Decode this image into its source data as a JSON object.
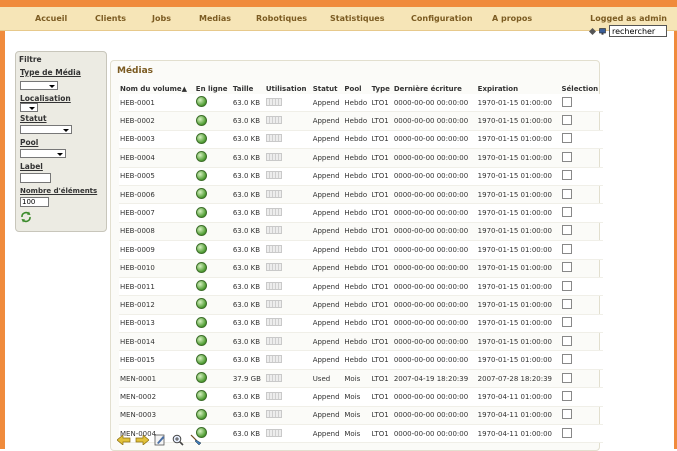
{
  "nav": [
    "Accueil",
    "Clients",
    "Jobs",
    "Medias",
    "Robotiques",
    "Statistiques",
    "Configuration",
    "A propos"
  ],
  "logged": {
    "text": "Logged as admin",
    "search_value": "rechercher"
  },
  "filter": {
    "title": "Filtre",
    "type_media": "Type de Média",
    "localisation": "Localisation",
    "statut": "Statut",
    "pool": "Pool",
    "label": "Label",
    "nombre": "Nombre d'éléments",
    "nombre_value": "100"
  },
  "panel": {
    "title": "Médias",
    "columns": [
      "Nom du volume▲",
      "En ligne",
      "Taille",
      "Utilisation",
      "Statut",
      "Pool",
      "Type",
      "Dernière écriture",
      "Expiration",
      "Sélection"
    ]
  },
  "rows": [
    {
      "name": "HEB-0001",
      "size": "63.0 KB",
      "status": "Append",
      "pool": "Hebdo",
      "type": "LTO1",
      "last": "0000-00-00 00:00:00",
      "exp": "1970-01-15 01:00:00"
    },
    {
      "name": "HEB-0002",
      "size": "63.0 KB",
      "status": "Append",
      "pool": "Hebdo",
      "type": "LTO1",
      "last": "0000-00-00 00:00:00",
      "exp": "1970-01-15 01:00:00"
    },
    {
      "name": "HEB-0003",
      "size": "63.0 KB",
      "status": "Append",
      "pool": "Hebdo",
      "type": "LTO1",
      "last": "0000-00-00 00:00:00",
      "exp": "1970-01-15 01:00:00"
    },
    {
      "name": "HEB-0004",
      "size": "63.0 KB",
      "status": "Append",
      "pool": "Hebdo",
      "type": "LTO1",
      "last": "0000-00-00 00:00:00",
      "exp": "1970-01-15 01:00:00"
    },
    {
      "name": "HEB-0005",
      "size": "63.0 KB",
      "status": "Append",
      "pool": "Hebdo",
      "type": "LTO1",
      "last": "0000-00-00 00:00:00",
      "exp": "1970-01-15 01:00:00"
    },
    {
      "name": "HEB-0006",
      "size": "63.0 KB",
      "status": "Append",
      "pool": "Hebdo",
      "type": "LTO1",
      "last": "0000-00-00 00:00:00",
      "exp": "1970-01-15 01:00:00"
    },
    {
      "name": "HEB-0007",
      "size": "63.0 KB",
      "status": "Append",
      "pool": "Hebdo",
      "type": "LTO1",
      "last": "0000-00-00 00:00:00",
      "exp": "1970-01-15 01:00:00"
    },
    {
      "name": "HEB-0008",
      "size": "63.0 KB",
      "status": "Append",
      "pool": "Hebdo",
      "type": "LTO1",
      "last": "0000-00-00 00:00:00",
      "exp": "1970-01-15 01:00:00"
    },
    {
      "name": "HEB-0009",
      "size": "63.0 KB",
      "status": "Append",
      "pool": "Hebdo",
      "type": "LTO1",
      "last": "0000-00-00 00:00:00",
      "exp": "1970-01-15 01:00:00"
    },
    {
      "name": "HEB-0010",
      "size": "63.0 KB",
      "status": "Append",
      "pool": "Hebdo",
      "type": "LTO1",
      "last": "0000-00-00 00:00:00",
      "exp": "1970-01-15 01:00:00"
    },
    {
      "name": "HEB-0011",
      "size": "63.0 KB",
      "status": "Append",
      "pool": "Hebdo",
      "type": "LTO1",
      "last": "0000-00-00 00:00:00",
      "exp": "1970-01-15 01:00:00"
    },
    {
      "name": "HEB-0012",
      "size": "63.0 KB",
      "status": "Append",
      "pool": "Hebdo",
      "type": "LTO1",
      "last": "0000-00-00 00:00:00",
      "exp": "1970-01-15 01:00:00"
    },
    {
      "name": "HEB-0013",
      "size": "63.0 KB",
      "status": "Append",
      "pool": "Hebdo",
      "type": "LTO1",
      "last": "0000-00-00 00:00:00",
      "exp": "1970-01-15 01:00:00"
    },
    {
      "name": "HEB-0014",
      "size": "63.0 KB",
      "status": "Append",
      "pool": "Hebdo",
      "type": "LTO1",
      "last": "0000-00-00 00:00:00",
      "exp": "1970-01-15 01:00:00"
    },
    {
      "name": "HEB-0015",
      "size": "63.0 KB",
      "status": "Append",
      "pool": "Hebdo",
      "type": "LTO1",
      "last": "0000-00-00 00:00:00",
      "exp": "1970-01-15 01:00:00"
    },
    {
      "name": "MEN-0001",
      "size": "37.9 GB",
      "status": "Used",
      "pool": "Mois",
      "type": "LTO1",
      "last": "2007-04-19 18:20:39",
      "exp": "2007-07-28 18:20:39"
    },
    {
      "name": "MEN-0002",
      "size": "63.0 KB",
      "status": "Append",
      "pool": "Mois",
      "type": "LTO1",
      "last": "0000-00-00 00:00:00",
      "exp": "1970-04-11 01:00:00"
    },
    {
      "name": "MEN-0003",
      "size": "63.0 KB",
      "status": "Append",
      "pool": "Mois",
      "type": "LTO1",
      "last": "0000-00-00 00:00:00",
      "exp": "1970-04-11 01:00:00"
    },
    {
      "name": "MEN-0004",
      "size": "63.0 KB",
      "status": "Append",
      "pool": "Mois",
      "type": "LTO1",
      "last": "0000-00-00 00:00:00",
      "exp": "1970-04-11 01:00:00"
    }
  ]
}
